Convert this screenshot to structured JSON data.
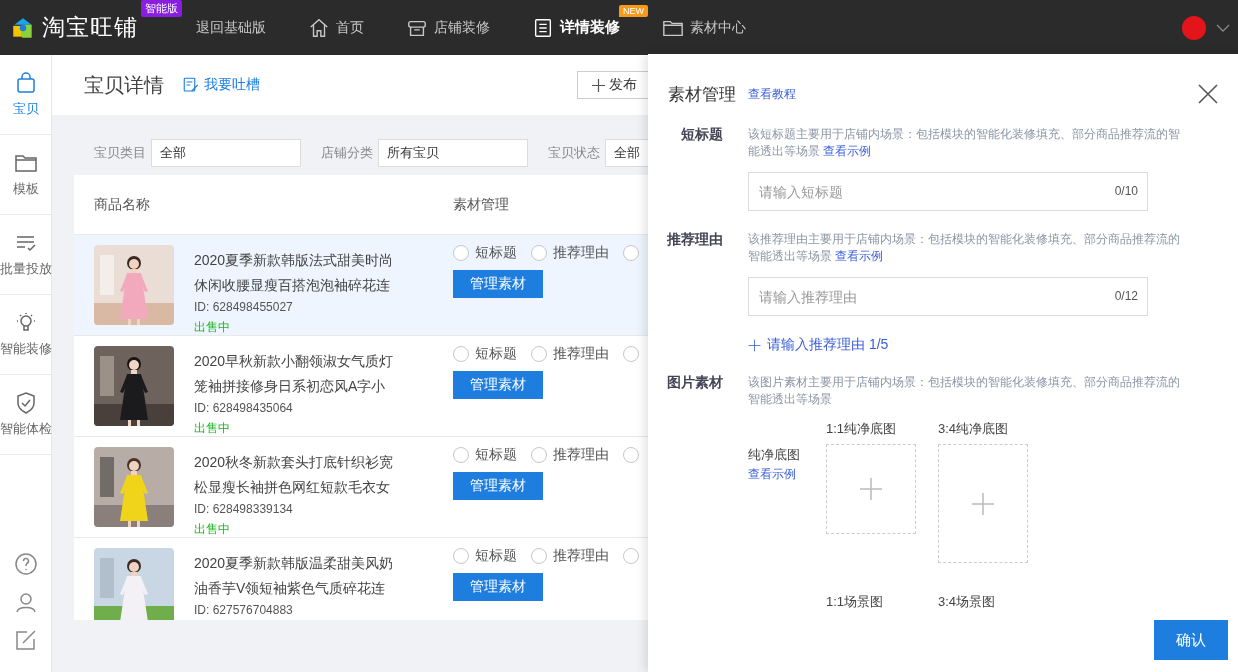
{
  "topbar": {
    "logo": "淘宝旺铺",
    "edition_badge": "智能版",
    "nav": [
      {
        "label": "退回基础版",
        "selected": false
      },
      {
        "label": "首页",
        "selected": false
      },
      {
        "label": "店铺装修",
        "selected": false
      },
      {
        "label": "详情装修",
        "selected": true,
        "badge": "NEW"
      },
      {
        "label": "素材中心",
        "selected": false
      }
    ]
  },
  "sidebar": {
    "items": [
      {
        "label": "宝贝",
        "selected": true
      },
      {
        "label": "模板",
        "selected": false
      },
      {
        "label": "批量投放",
        "selected": false
      },
      {
        "label": "智能装修",
        "selected": false
      },
      {
        "label": "智能体检",
        "selected": false
      }
    ]
  },
  "page": {
    "title": "宝贝详情",
    "feedback_link": "我要吐槽",
    "publish_button": "发布"
  },
  "filters": [
    {
      "label": "宝贝类目",
      "value": "全部"
    },
    {
      "label": "店铺分类",
      "value": "所有宝贝"
    },
    {
      "label": "宝贝状态",
      "value": "全部"
    }
  ],
  "table": {
    "columns": [
      "商品名称",
      "素材管理"
    ],
    "rows": [
      {
        "title": "2020夏季新款韩版法式甜美时尚休闲收腰显瘦百搭泡泡袖碎花连",
        "id": "ID: 628498455027",
        "status": "出售中",
        "highlighted": true,
        "options": [
          {
            "label": "短标题",
            "checked": false
          },
          {
            "label": "推荐理由",
            "checked": false
          },
          {
            "checked": false
          }
        ],
        "button": "管理素材"
      },
      {
        "title": "2020早秋新款小翻领淑女气质灯笼袖拼接修身日系初恋风A字小",
        "id": "ID: 628498435064",
        "status": "出售中",
        "highlighted": false,
        "options": [
          {
            "label": "短标题",
            "checked": false
          },
          {
            "label": "推荐理由",
            "checked": false
          },
          {
            "checked": false
          }
        ],
        "button": "管理素材"
      },
      {
        "title": "2020秋冬新款套头打底针织衫宽松显瘦长袖拼色网红短款毛衣女",
        "id": "ID: 628498339134",
        "status": "出售中",
        "highlighted": false,
        "options": [
          {
            "label": "短标题",
            "checked": false
          },
          {
            "label": "推荐理由",
            "checked": false
          },
          {
            "checked": false
          }
        ],
        "button": "管理素材"
      },
      {
        "title": "2020夏季新款韩版温柔甜美风奶油香芋V领短袖紫色气质碎花连",
        "id": "ID: 627576704883",
        "highlighted": false,
        "options": [
          {
            "label": "短标题",
            "checked": false
          },
          {
            "label": "推荐理由",
            "checked": false
          },
          {
            "checked": false
          }
        ],
        "button": "管理素材"
      }
    ]
  },
  "drawer": {
    "title": "素材管理",
    "tutorial_link": "查看教程",
    "sections": [
      {
        "kind": "text",
        "label": "短标题",
        "description": "该短标题主要用于店铺内场景：包括模块的智能化装修填充、部分商品推荐流的智能透出等场景",
        "example_link": "查看示例",
        "placeholder": "请输入短标题",
        "counter": "0/10"
      },
      {
        "kind": "text",
        "label": "推荐理由",
        "description": "该推荐理由主要用于店铺内场景：包括模块的智能化装修填充、部分商品推荐流的智能透出等场景",
        "example_link": "查看示例",
        "placeholder": "请输入推荐理由",
        "counter": "0/12",
        "add_link": "请输入推荐理由 1/5"
      },
      {
        "kind": "images",
        "label": "图片素材",
        "description": "该图片素材主要用于店铺内场景：包括模块的智能化装修填充、部分商品推荐流的智能透出等场景",
        "groups": [
          {
            "label": "纯净底图",
            "example_link": "查看示例",
            "slots": [
              {
                "label": "1:1纯净底图",
                "kind": "square"
              },
              {
                "label": "3:4纯净底图",
                "kind": "portrait"
              }
            ]
          },
          {
            "slots": [
              {
                "label": "1:1场景图",
                "kind": "label"
              },
              {
                "label": "3:4场景图",
                "kind": "label"
              }
            ]
          }
        ]
      }
    ],
    "confirm_button": "确认"
  }
}
